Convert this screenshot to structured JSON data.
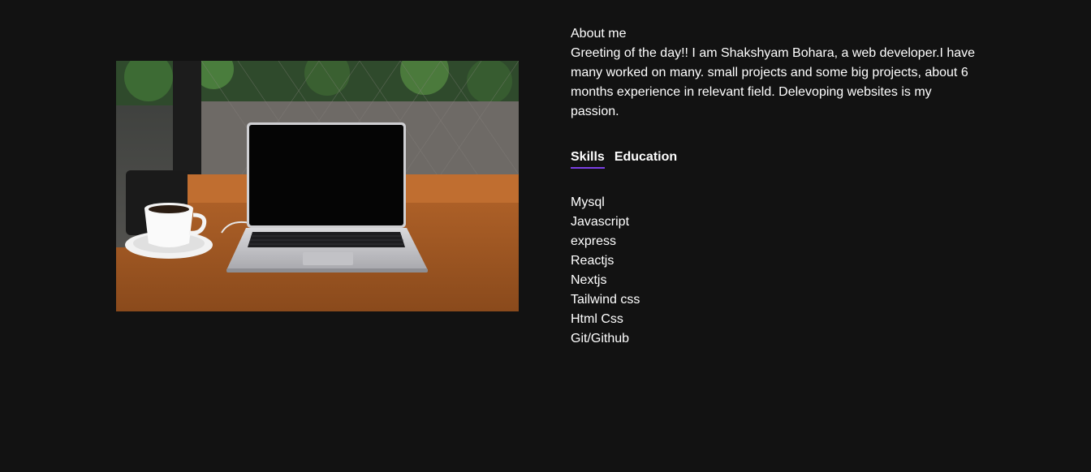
{
  "about": {
    "title": "About me",
    "text": "Greeting of the day!! I am Shakshyam Bohara, a web developer.I have many worked on many. small projects and some big projects, about 6 months experience in relevant field. Delevoping websites is my passion."
  },
  "tabs": [
    {
      "label": "Skills",
      "active": true
    },
    {
      "label": "Education",
      "active": false
    }
  ],
  "skills": [
    "Mysql",
    "Javascript",
    "express",
    "Reactjs",
    "Nextjs",
    "Tailwind css",
    "Html Css",
    "Git/Github"
  ],
  "colors": {
    "background": "#121212",
    "text": "#ffffff",
    "accent": "#7b3fe4"
  }
}
